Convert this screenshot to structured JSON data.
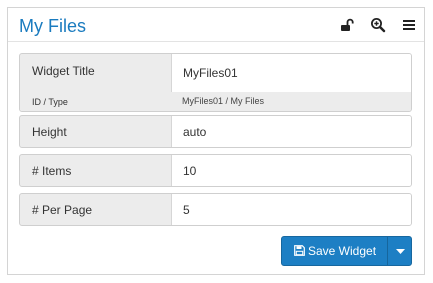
{
  "widget": {
    "title": "My Files",
    "icons": [
      "unlock-icon",
      "zoom-in-icon",
      "menu-icon"
    ]
  },
  "fields": {
    "widget_title": {
      "label": "Widget Title",
      "value": "MyFiles01"
    },
    "id_type": {
      "label": "ID / Type",
      "value": "MyFiles01 / My Files"
    },
    "height": {
      "label": "Height",
      "value": "auto"
    },
    "items": {
      "label": "# Items",
      "value": "10"
    },
    "per_page": {
      "label": "# Per Page",
      "value": "5"
    }
  },
  "actions": {
    "save_label": "Save Widget"
  },
  "colors": {
    "title": "#1a7bbf",
    "button": "#1d7fc4"
  }
}
